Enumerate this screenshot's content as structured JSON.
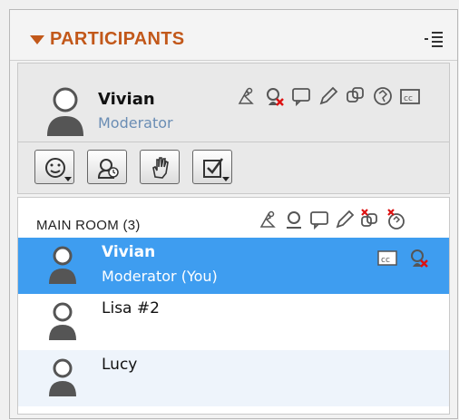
{
  "panel": {
    "title": "PARTICIPANTS",
    "menu_icon": "options-menu-icon"
  },
  "me": {
    "name": "Vivian",
    "role": "Moderator",
    "permission_icons": [
      "host-icon",
      "audio-mute-icon",
      "chat-icon",
      "draw-icon",
      "share-icon",
      "web-icon",
      "cc-icon"
    ]
  },
  "status_buttons": [
    {
      "name": "emoticon-button",
      "icon": "smiley-icon",
      "dropdown": true
    },
    {
      "name": "away-button",
      "icon": "away-clock-icon",
      "dropdown": false
    },
    {
      "name": "raise-hand-button",
      "icon": "raise-hand-icon",
      "dropdown": false
    },
    {
      "name": "answer-button",
      "icon": "checkbox-icon",
      "dropdown": true
    }
  ],
  "room": {
    "title": "MAIN ROOM (3)",
    "header_icons": [
      "host-icon",
      "audio-icon",
      "chat-icon",
      "draw-icon",
      "share-off-icon",
      "web-off-icon"
    ]
  },
  "participants": [
    {
      "name": "Vivian",
      "role": "Moderator (You)",
      "selected": true,
      "icons": [
        "cc-icon",
        "audio-mute-icon"
      ]
    },
    {
      "name": "Lisa #2",
      "role": "",
      "selected": false,
      "icons": []
    },
    {
      "name": "Lucy",
      "role": "",
      "selected": false,
      "icons": []
    }
  ],
  "colors": {
    "accent": "#c2581a",
    "selected_row": "#3e9df0",
    "role_text": "#6a8db4"
  }
}
